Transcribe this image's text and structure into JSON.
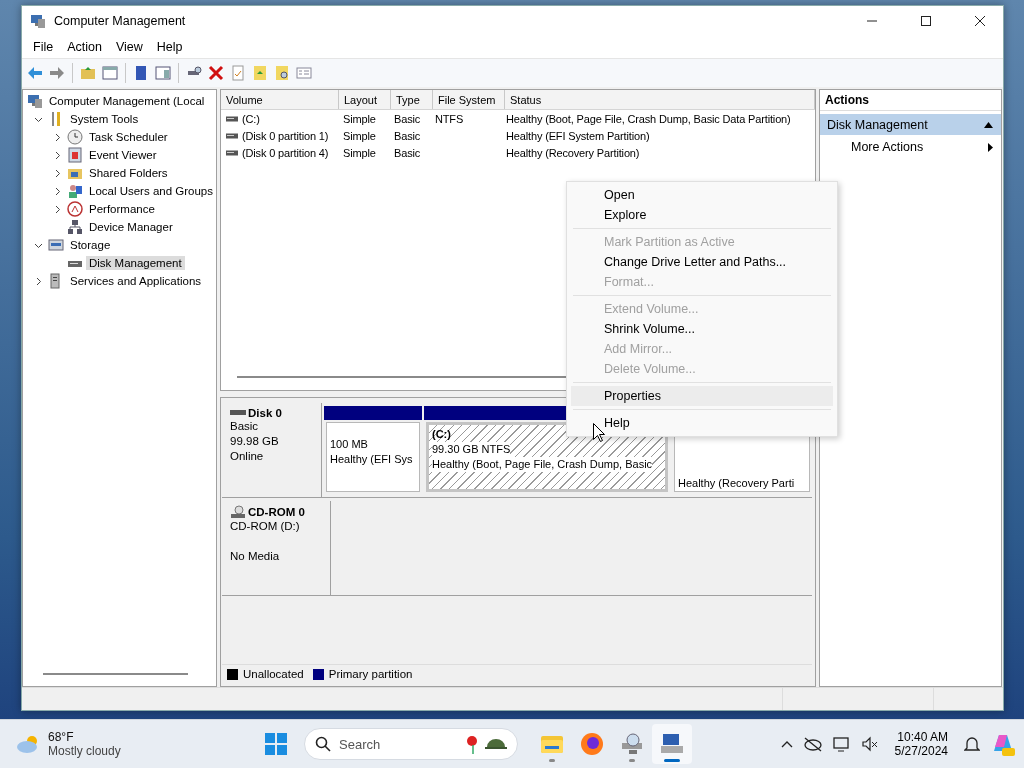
{
  "window": {
    "title": "Computer Management"
  },
  "menu_bar": [
    "File",
    "Action",
    "View",
    "Help"
  ],
  "tree": [
    {
      "label": "Computer Management (Local",
      "children": [
        {
          "label": "System Tools",
          "expanded": true,
          "children": [
            {
              "label": "Task Scheduler",
              "expanded": false
            },
            {
              "label": "Event Viewer",
              "expanded": false
            },
            {
              "label": "Shared Folders",
              "expanded": false
            },
            {
              "label": "Local Users and Groups",
              "expanded": false
            },
            {
              "label": "Performance",
              "expanded": false
            },
            {
              "label": "Device Manager"
            }
          ]
        },
        {
          "label": "Storage",
          "expanded": true,
          "children": [
            {
              "label": "Disk Management",
              "selected": true
            }
          ]
        },
        {
          "label": "Services and Applications",
          "expanded": false
        }
      ]
    }
  ],
  "volumes": {
    "columns": [
      "Volume",
      "Layout",
      "Type",
      "File System",
      "Status"
    ],
    "rows": [
      [
        "(C:)",
        "Simple",
        "Basic",
        "NTFS",
        "Healthy (Boot, Page File, Crash Dump, Basic Data Partition)"
      ],
      [
        "(Disk 0 partition 1)",
        "Simple",
        "Basic",
        "",
        "Healthy (EFI System Partition)"
      ],
      [
        "(Disk 0 partition 4)",
        "Simple",
        "Basic",
        "",
        "Healthy (Recovery Partition)"
      ]
    ]
  },
  "disks": [
    {
      "kind": "disk",
      "name": "Disk 0",
      "type": "Basic",
      "size": "99.98 GB",
      "status": "Online",
      "partitions": [
        {
          "size": "100 MB",
          "status": "Healthy (EFI Sys",
          "selected": false
        },
        {
          "title": "(C:)",
          "size": "99.30 GB NTFS",
          "status": "Healthy (Boot, Page File, Crash Dump, Basic",
          "selected": true
        },
        {
          "status": "Healthy (Recovery Parti",
          "selected": false
        }
      ]
    },
    {
      "kind": "cdrom",
      "name": "CD-ROM 0",
      "type": "CD-ROM (D:)",
      "status": "No Media"
    }
  ],
  "legend": [
    {
      "label": "Unallocated",
      "color": "#000000"
    },
    {
      "label": "Primary partition",
      "color": "#00007f"
    }
  ],
  "actions": {
    "title": "Actions",
    "section": "Disk Management",
    "expanded": true,
    "items": [
      "More Actions"
    ]
  },
  "context_menu": {
    "groups": [
      {
        "items": [
          {
            "label": "Open",
            "disabled": false,
            "selected": false
          },
          {
            "label": "Explore",
            "disabled": false,
            "selected": false
          }
        ]
      },
      {
        "items": [
          {
            "label": "Mark Partition as Active",
            "disabled": true,
            "selected": false
          },
          {
            "label": "Change Drive Letter and Paths...",
            "disabled": false,
            "selected": false
          },
          {
            "label": "Format...",
            "disabled": true,
            "selected": false
          }
        ]
      },
      {
        "items": [
          {
            "label": "Extend Volume...",
            "disabled": true,
            "selected": false
          },
          {
            "label": "Shrink Volume...",
            "disabled": false,
            "selected": false
          },
          {
            "label": "Add Mirror...",
            "disabled": true,
            "selected": false
          },
          {
            "label": "Delete Volume...",
            "disabled": true,
            "selected": false
          }
        ]
      },
      {
        "items": [
          {
            "label": "Properties",
            "disabled": false,
            "selected": true
          }
        ]
      },
      {
        "items": [
          {
            "label": "Help",
            "disabled": false,
            "selected": false
          }
        ]
      }
    ]
  },
  "taskbar": {
    "temperature": "68°F",
    "condition": "Mostly cloudy",
    "search_placeholder": "Search",
    "apps": [
      {
        "kind": "explorer",
        "running": true,
        "active": false
      },
      {
        "kind": "firefox",
        "running": false,
        "active": false
      },
      {
        "kind": "network",
        "running": true,
        "active": false
      },
      {
        "kind": "management",
        "running": true,
        "active": true
      }
    ],
    "time": "10:40 AM",
    "date": "5/27/2024"
  }
}
